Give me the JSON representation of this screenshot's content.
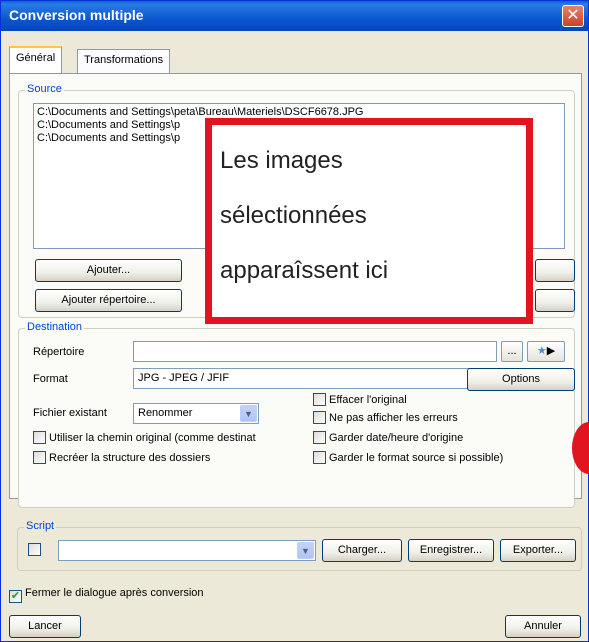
{
  "window": {
    "title": "Conversion multiple",
    "close_glyph": "✕"
  },
  "tabs": [
    {
      "label": "Général",
      "active": true
    },
    {
      "label": "Transformations",
      "active": false
    }
  ],
  "source": {
    "legend": "Source",
    "files": [
      "C:\\Documents and Settings\\peta\\Bureau\\Materiels\\DSCF6678.JPG",
      "C:\\Documents and Settings\\p",
      "C:\\Documents and Settings\\p"
    ],
    "add_label": "Ajouter...",
    "add_folder_label": "Ajouter répertoire..."
  },
  "overlay": {
    "lines": [
      "Les images",
      "sélectionnées",
      "apparaîssent ici"
    ]
  },
  "destination": {
    "legend": "Destination",
    "directory_label": "Répertoire",
    "directory_value": "",
    "browse_label": "...",
    "format_label": "Format",
    "format_value": "JPG - JPEG / JFIF",
    "options_label": "Options",
    "existing_label": "Fichier existant",
    "existing_value": "Renommer",
    "checkboxes": {
      "delete_original": {
        "label": "Effacer l'original",
        "checked": false
      },
      "hide_errors": {
        "label": "Ne pas afficher les erreurs",
        "checked": false
      },
      "keep_date": {
        "label": "Garder date/heure d'origine",
        "checked": false
      },
      "keep_format": {
        "label": "Garder le format source si possible)",
        "checked": false
      },
      "use_original_path": {
        "label": "Utiliser la chemin original (comme destinat",
        "checked": false
      },
      "recreate_structure": {
        "label": "Recréer la structure des dossiers",
        "checked": false
      }
    }
  },
  "script": {
    "legend": "Script",
    "value": "",
    "load_label": "Charger...",
    "save_label": "Enregistrer...",
    "export_label": "Exporter..."
  },
  "footer": {
    "close_after_label": "Fermer le dialogue après conversion",
    "close_after_checked": true,
    "start_label": "Lancer",
    "cancel_label": "Annuler"
  },
  "colors": {
    "accent": "#0046d5",
    "highlight_red": "#e1141f"
  }
}
